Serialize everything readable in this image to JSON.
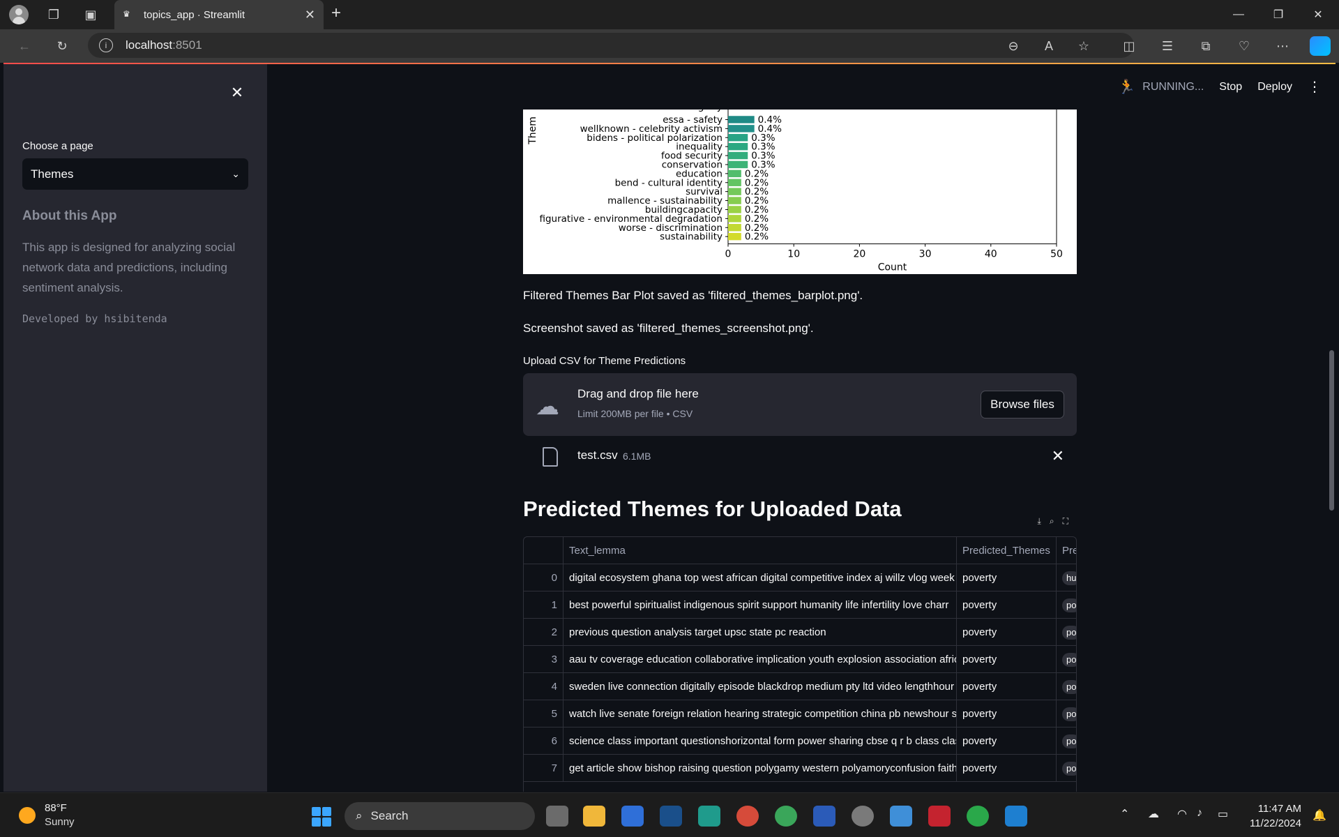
{
  "browser": {
    "tab_title": "topics_app · Streamlit",
    "url_host": "localhost",
    "url_port": ":8501"
  },
  "sidebar": {
    "choose_label": "Choose a page",
    "selected_page": "Themes",
    "about_title": "About this App",
    "about_text": "This app is designed for analyzing social network data and predictions, including sentiment analysis.",
    "developer": "Developed by hsibitenda"
  },
  "header": {
    "status": "RUNNING...",
    "stop": "Stop",
    "deploy": "Deploy"
  },
  "chart_data": {
    "type": "bar",
    "orientation": "horizontal",
    "ylabel": "Them",
    "xlabel": "Count",
    "xlim": [
      0,
      50
    ],
    "xticks": [
      "0",
      "10",
      "20",
      "30",
      "40",
      "50"
    ],
    "partial_top_label": "discrimination - glory",
    "categories": [
      "essa - safety",
      "wellknown - celebrity activism",
      "bidens - political polarization",
      "inequality",
      "food security",
      "conservation",
      "education",
      "bend - cultural identity",
      "survival",
      "mallence - sustainability",
      "buildingcapacity",
      "figurative - environmental degradation",
      "worse - discrimination",
      "sustainability"
    ],
    "values": [
      4,
      4,
      3,
      3,
      3,
      3,
      2,
      2,
      2,
      2,
      2,
      2,
      2,
      2
    ],
    "labels": [
      "0.4%",
      "0.4%",
      "0.3%",
      "0.3%",
      "0.3%",
      "0.3%",
      "0.2%",
      "0.2%",
      "0.2%",
      "0.2%",
      "0.2%",
      "0.2%",
      "0.2%",
      "0.2%"
    ],
    "colors": [
      "#1f8a86",
      "#22908a",
      "#27a385",
      "#2ba882",
      "#33ad7d",
      "#3db477",
      "#52bd6c",
      "#62c463",
      "#74c95a",
      "#86cd4f",
      "#9ad245",
      "#aed63b",
      "#c2d932",
      "#d3db2c"
    ]
  },
  "main": {
    "caption1": "Filtered Themes Bar Plot saved as 'filtered_themes_barplot.png'.",
    "caption2": "Screenshot saved as 'filtered_themes_screenshot.png'.",
    "upload_label": "Upload CSV for Theme Predictions",
    "drop_title": "Drag and drop file here",
    "drop_limit": "Limit 200MB per file • CSV",
    "browse": "Browse files",
    "file_name": "test.csv",
    "file_size": "6.1MB",
    "section_title": "Predicted Themes for Uploaded Data"
  },
  "table": {
    "columns": [
      "",
      "Text_lemma",
      "Predicted_Themes",
      "Pre"
    ],
    "rows": [
      {
        "idx": "0",
        "text": "digital ecosystem ghana top west african digital competitive index aj willz vlog week v",
        "theme": "poverty",
        "pred": "hu"
      },
      {
        "idx": "1",
        "text": "best powerful spiritualist indigenous spirit support humanity life infertility love charr",
        "theme": "poverty",
        "pred": "po"
      },
      {
        "idx": "2",
        "text": "previous question analysis target upsc state pc reaction",
        "theme": "poverty",
        "pred": "po"
      },
      {
        "idx": "3",
        "text": "aau tv coverage education collaborative implication youth explosion association afric",
        "theme": "poverty",
        "pred": "po"
      },
      {
        "idx": "4",
        "text": "sweden live connection digitally episode blackdrop medium pty ltd video lengthhour",
        "theme": "poverty",
        "pred": "po"
      },
      {
        "idx": "5",
        "text": "watch live senate foreign relation hearing strategic competition china pb newshour st",
        "theme": "poverty",
        "pred": "po"
      },
      {
        "idx": "6",
        "text": "science class important questionshorizontal form power sharing cbse q r b class class",
        "theme": "poverty",
        "pred": "po"
      },
      {
        "idx": "7",
        "text": "get article show bishop raising question polygamy western polyamoryconfusion faith",
        "theme": "poverty",
        "pred": "po"
      }
    ]
  },
  "taskbar": {
    "temp": "88°F",
    "weather": "Sunny",
    "search": "Search",
    "time": "11:47 AM",
    "date": "11/22/2024"
  }
}
